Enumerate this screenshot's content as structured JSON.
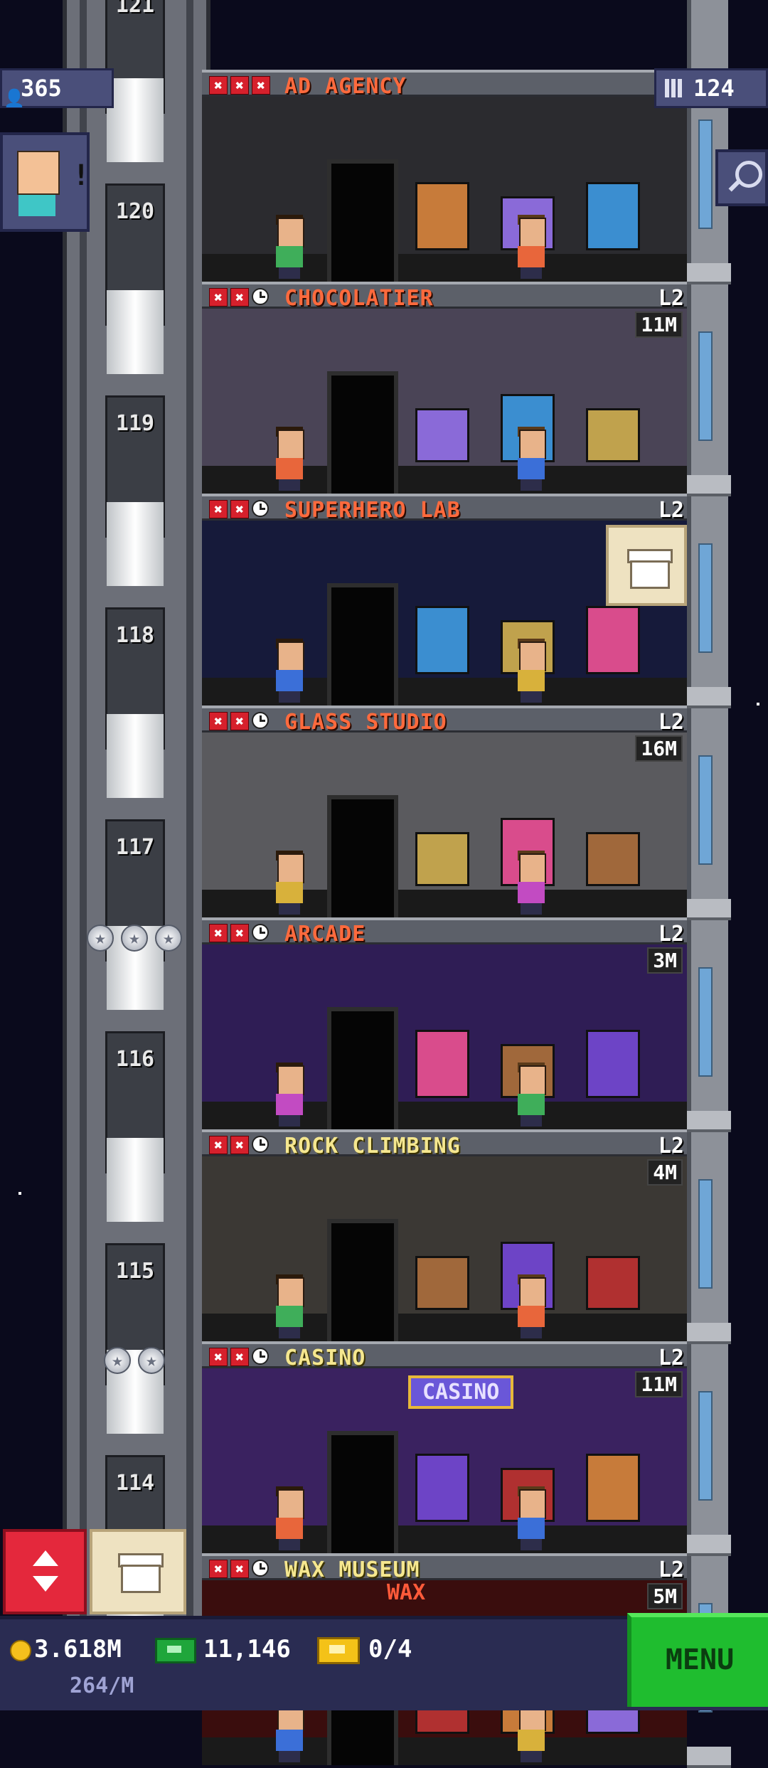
{
  "hud": {
    "population": "365",
    "floors": "124",
    "coins": "3.618M",
    "bux": "11,146",
    "tickets": "0/4",
    "income_rate": "264/M",
    "menu_label": "MENU"
  },
  "elevator": {
    "floor_numbers": [
      "121",
      "120",
      "119",
      "118",
      "117",
      "116",
      "115",
      "114"
    ]
  },
  "floors": [
    {
      "name": "AD AGENCY",
      "level": "",
      "income": ""
    },
    {
      "name": "CHOCOLATIER",
      "level": "L2",
      "income": "11M"
    },
    {
      "name": "SUPERHERO LAB",
      "level": "L2",
      "income": ""
    },
    {
      "name": "GLASS STUDIO",
      "level": "L2",
      "income": "16M"
    },
    {
      "name": "ARCADE",
      "level": "L2",
      "income": "3M"
    },
    {
      "name": "ROCK CLIMBING",
      "level": "L2",
      "income": "4M"
    },
    {
      "name": "CASINO",
      "level": "L2",
      "income": "11M"
    },
    {
      "name": "WAX MUSEUM",
      "level": "L2",
      "income": "5M"
    }
  ],
  "room_signs": {
    "casino_sign": "CASINO",
    "wax_sign": "WAX"
  },
  "colors": {
    "room_name_red": "#ff6a3d",
    "room_name_yellow": "#f5e78f",
    "menu_green": "#1fbd2f",
    "elevator_red": "#e4283c"
  }
}
